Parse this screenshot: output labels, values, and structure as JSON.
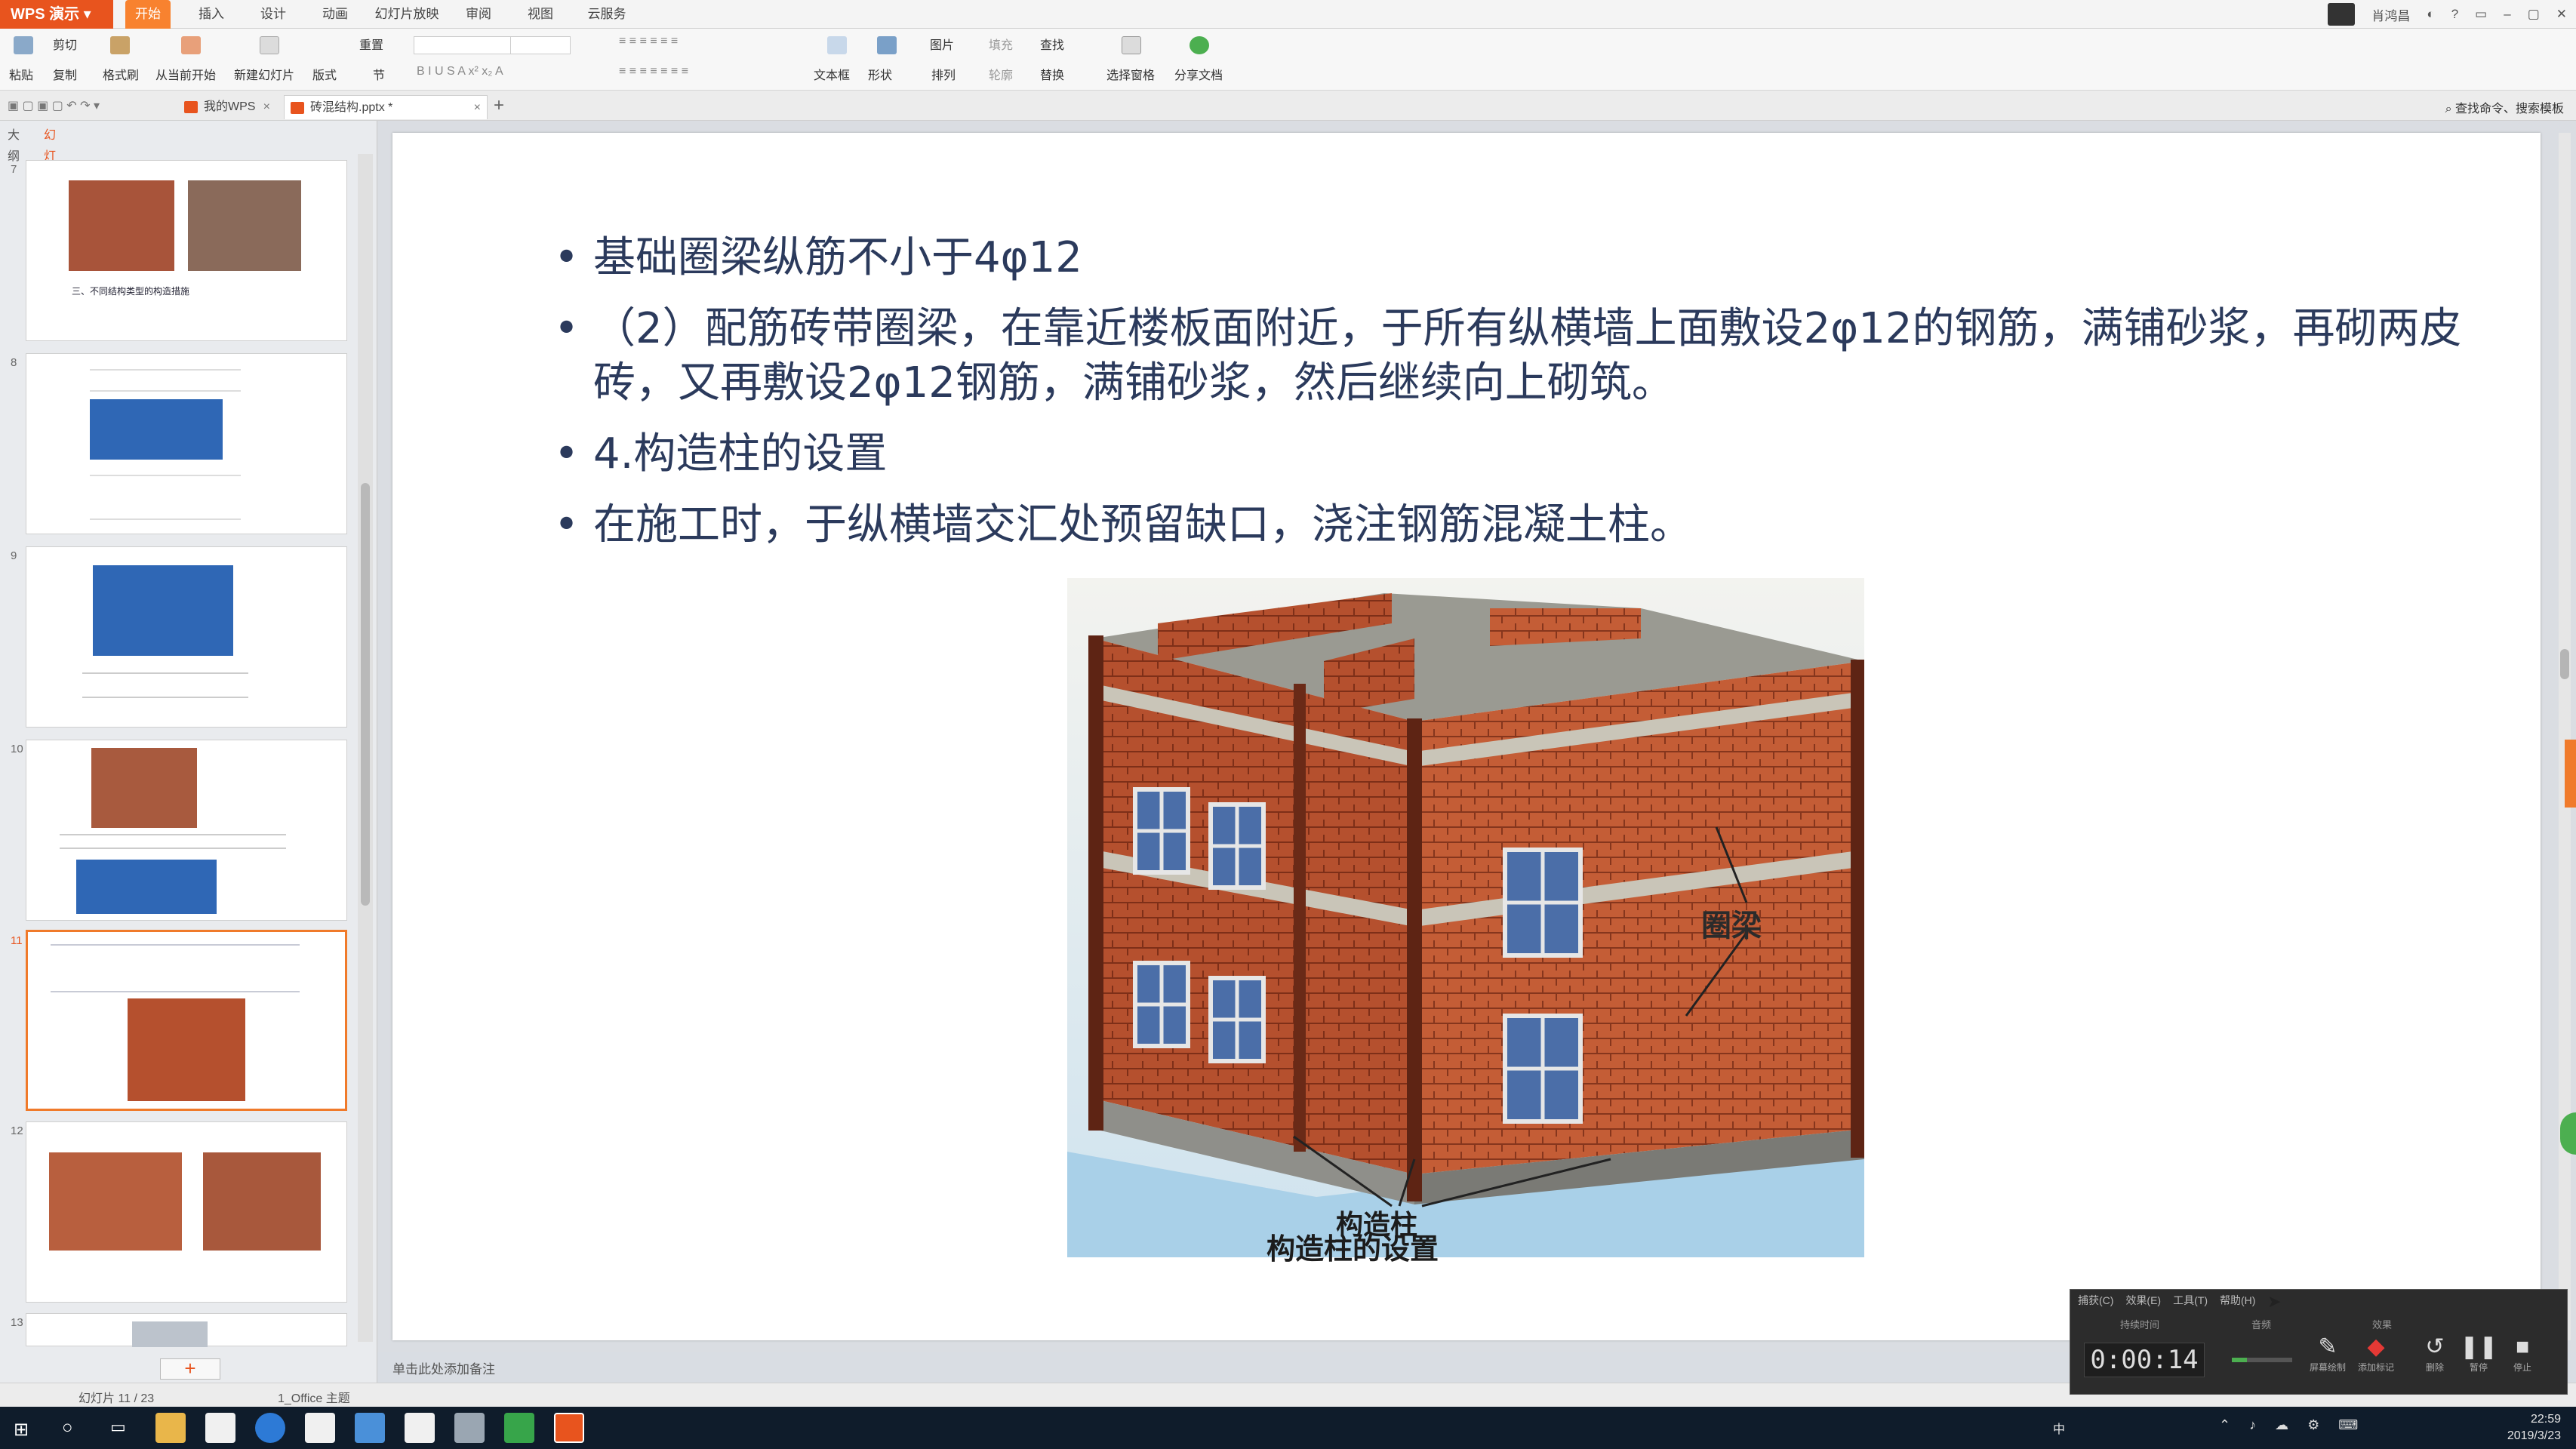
{
  "app": {
    "badge": "WPS 演示"
  },
  "menu": {
    "tabs": [
      "开始",
      "插入",
      "设计",
      "动画",
      "幻灯片放映",
      "审阅",
      "视图",
      "云服务"
    ],
    "active": "开始",
    "user": "肖鸿昌"
  },
  "ribbon": {
    "paste": "粘贴",
    "cut": "剪切",
    "copy": "复制",
    "format_painter": "格式刷",
    "from_current": "从当前开始",
    "new_slide": "新建幻灯片",
    "layout": "版式",
    "reset": "重置",
    "section": "节",
    "textbox": "文本框",
    "shape": "形状",
    "arrange": "排列",
    "picture": "图片",
    "fill": "填充",
    "outline": "轮廓",
    "find": "查找",
    "replace": "替换",
    "select_pane": "选择窗格",
    "share_doc": "分享文档",
    "search_cmd": "查找命令、搜索模板"
  },
  "doc_tabs": [
    {
      "label": "我的WPS"
    },
    {
      "label": "砖混结构.pptx *"
    }
  ],
  "left_panel": {
    "tabs": [
      "大纲",
      "幻灯片"
    ],
    "active_tab": "幻灯片",
    "thumbs": [
      {
        "num": "7",
        "caption": "三、不同结构类型的构造措施"
      },
      {
        "num": "8",
        "caption": ""
      },
      {
        "num": "9",
        "caption": ""
      },
      {
        "num": "10",
        "caption": ""
      },
      {
        "num": "11",
        "caption": ""
      },
      {
        "num": "12",
        "caption": ""
      },
      {
        "num": "13",
        "caption": ""
      }
    ],
    "active_slide": "11",
    "add_label": "+"
  },
  "slide": {
    "bullets": [
      "基础圈梁纵筋不小于4φ12",
      "（2）配筋砖带圈梁，在靠近楼板面附近，于所有纵横墙上面敷设2φ12的钢筋，满铺砂浆，再砌两皮砖，又再敷设2φ12钢筋，满铺砂浆，然后继续向上砌筑。",
      "4.构造柱的设置",
      "在施工时，于纵横墙交汇处预留缺口，浇注钢筋混凝土柱。"
    ],
    "image_labels": {
      "ring_beam": "圈梁",
      "column": "构造柱",
      "caption": "构造柱的设置"
    }
  },
  "notes_placeholder": "单击此处添加备注",
  "status": {
    "slide_count": "幻灯片 11 / 23",
    "theme": "1_Office 主题"
  },
  "recorder": {
    "menu": [
      "捕获(C)",
      "效果(E)",
      "工具(T)",
      "帮助(H)"
    ],
    "duration_label": "持续时间",
    "audio_label": "音频",
    "record_label": "效果",
    "time": "0:00:14",
    "buttons": [
      "屏幕绘制",
      "添加标记",
      "删除",
      "暂停",
      "停止"
    ]
  },
  "taskbar": {
    "time": "22:59",
    "date": "2019/3/23",
    "ime": "中"
  },
  "colors": {
    "accent": "#f8822f",
    "brand": "#e8541e",
    "bullet_text": "#2b3a5c",
    "brick": "#b5502e",
    "taskbar": "#0f1c2b"
  }
}
